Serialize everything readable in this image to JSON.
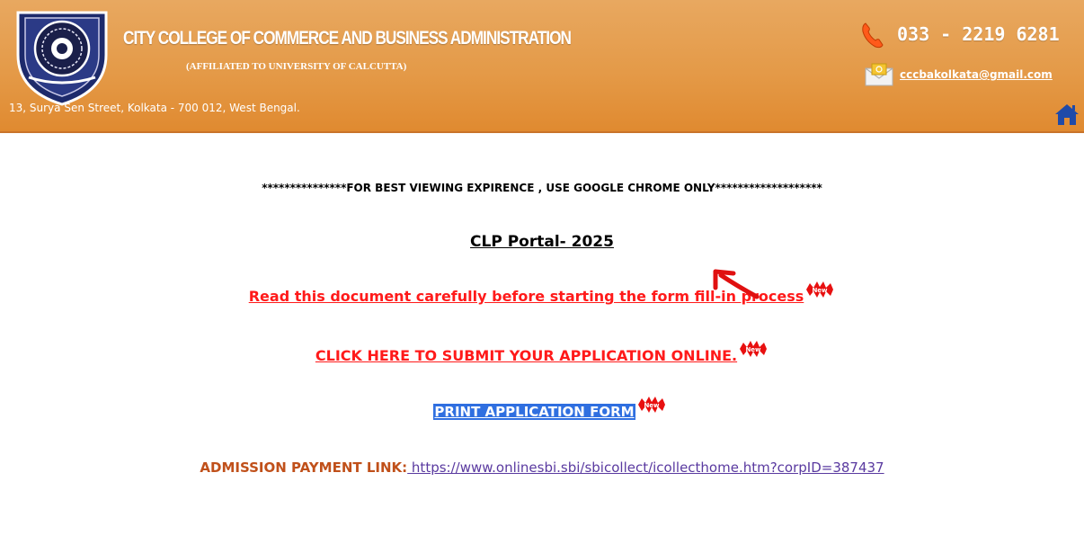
{
  "header": {
    "college_name": "CITY COLLEGE OF COMMERCE AND BUSINESS ADMINISTRATION",
    "affiliation": "(AFFILIATED TO UNIVERSITY OF CALCUTTA)",
    "address": "13, Surya Sen Street, Kolkata - 700 012, West Bengal.",
    "phone": "033 - 2219 6281",
    "email": "cccbakolkata@gmail.com"
  },
  "main": {
    "notice": "***************FOR BEST VIEWING EXPIRENCE , USE GOOGLE CHROME ONLY*******************",
    "portal_title": "CLP Portal- 2025",
    "read_document_link": "Read this document carefully before starting the form fill-in process",
    "submit_link": "CLICK HERE TO SUBMIT YOUR APPLICATION ONLINE.",
    "print_link": "PRINT APPLICATION FORM",
    "payment_label": "ADMISSION PAYMENT LINK:",
    "payment_url": " https://www.onlinesbi.sbi/sbicollect/icollecthome.htm?corpID=387437",
    "new_badge": "New"
  },
  "colors": {
    "header_orange": "#e49a48",
    "link_red": "#ff1a1a",
    "highlight_blue": "#2f6fe0",
    "payment_label": "#c0501a",
    "payment_url": "#5a3aa0"
  },
  "icons": [
    "college-logo-icon",
    "phone-icon",
    "mail-icon",
    "home-icon",
    "new-badge-icon",
    "red-arrow-icon"
  ]
}
